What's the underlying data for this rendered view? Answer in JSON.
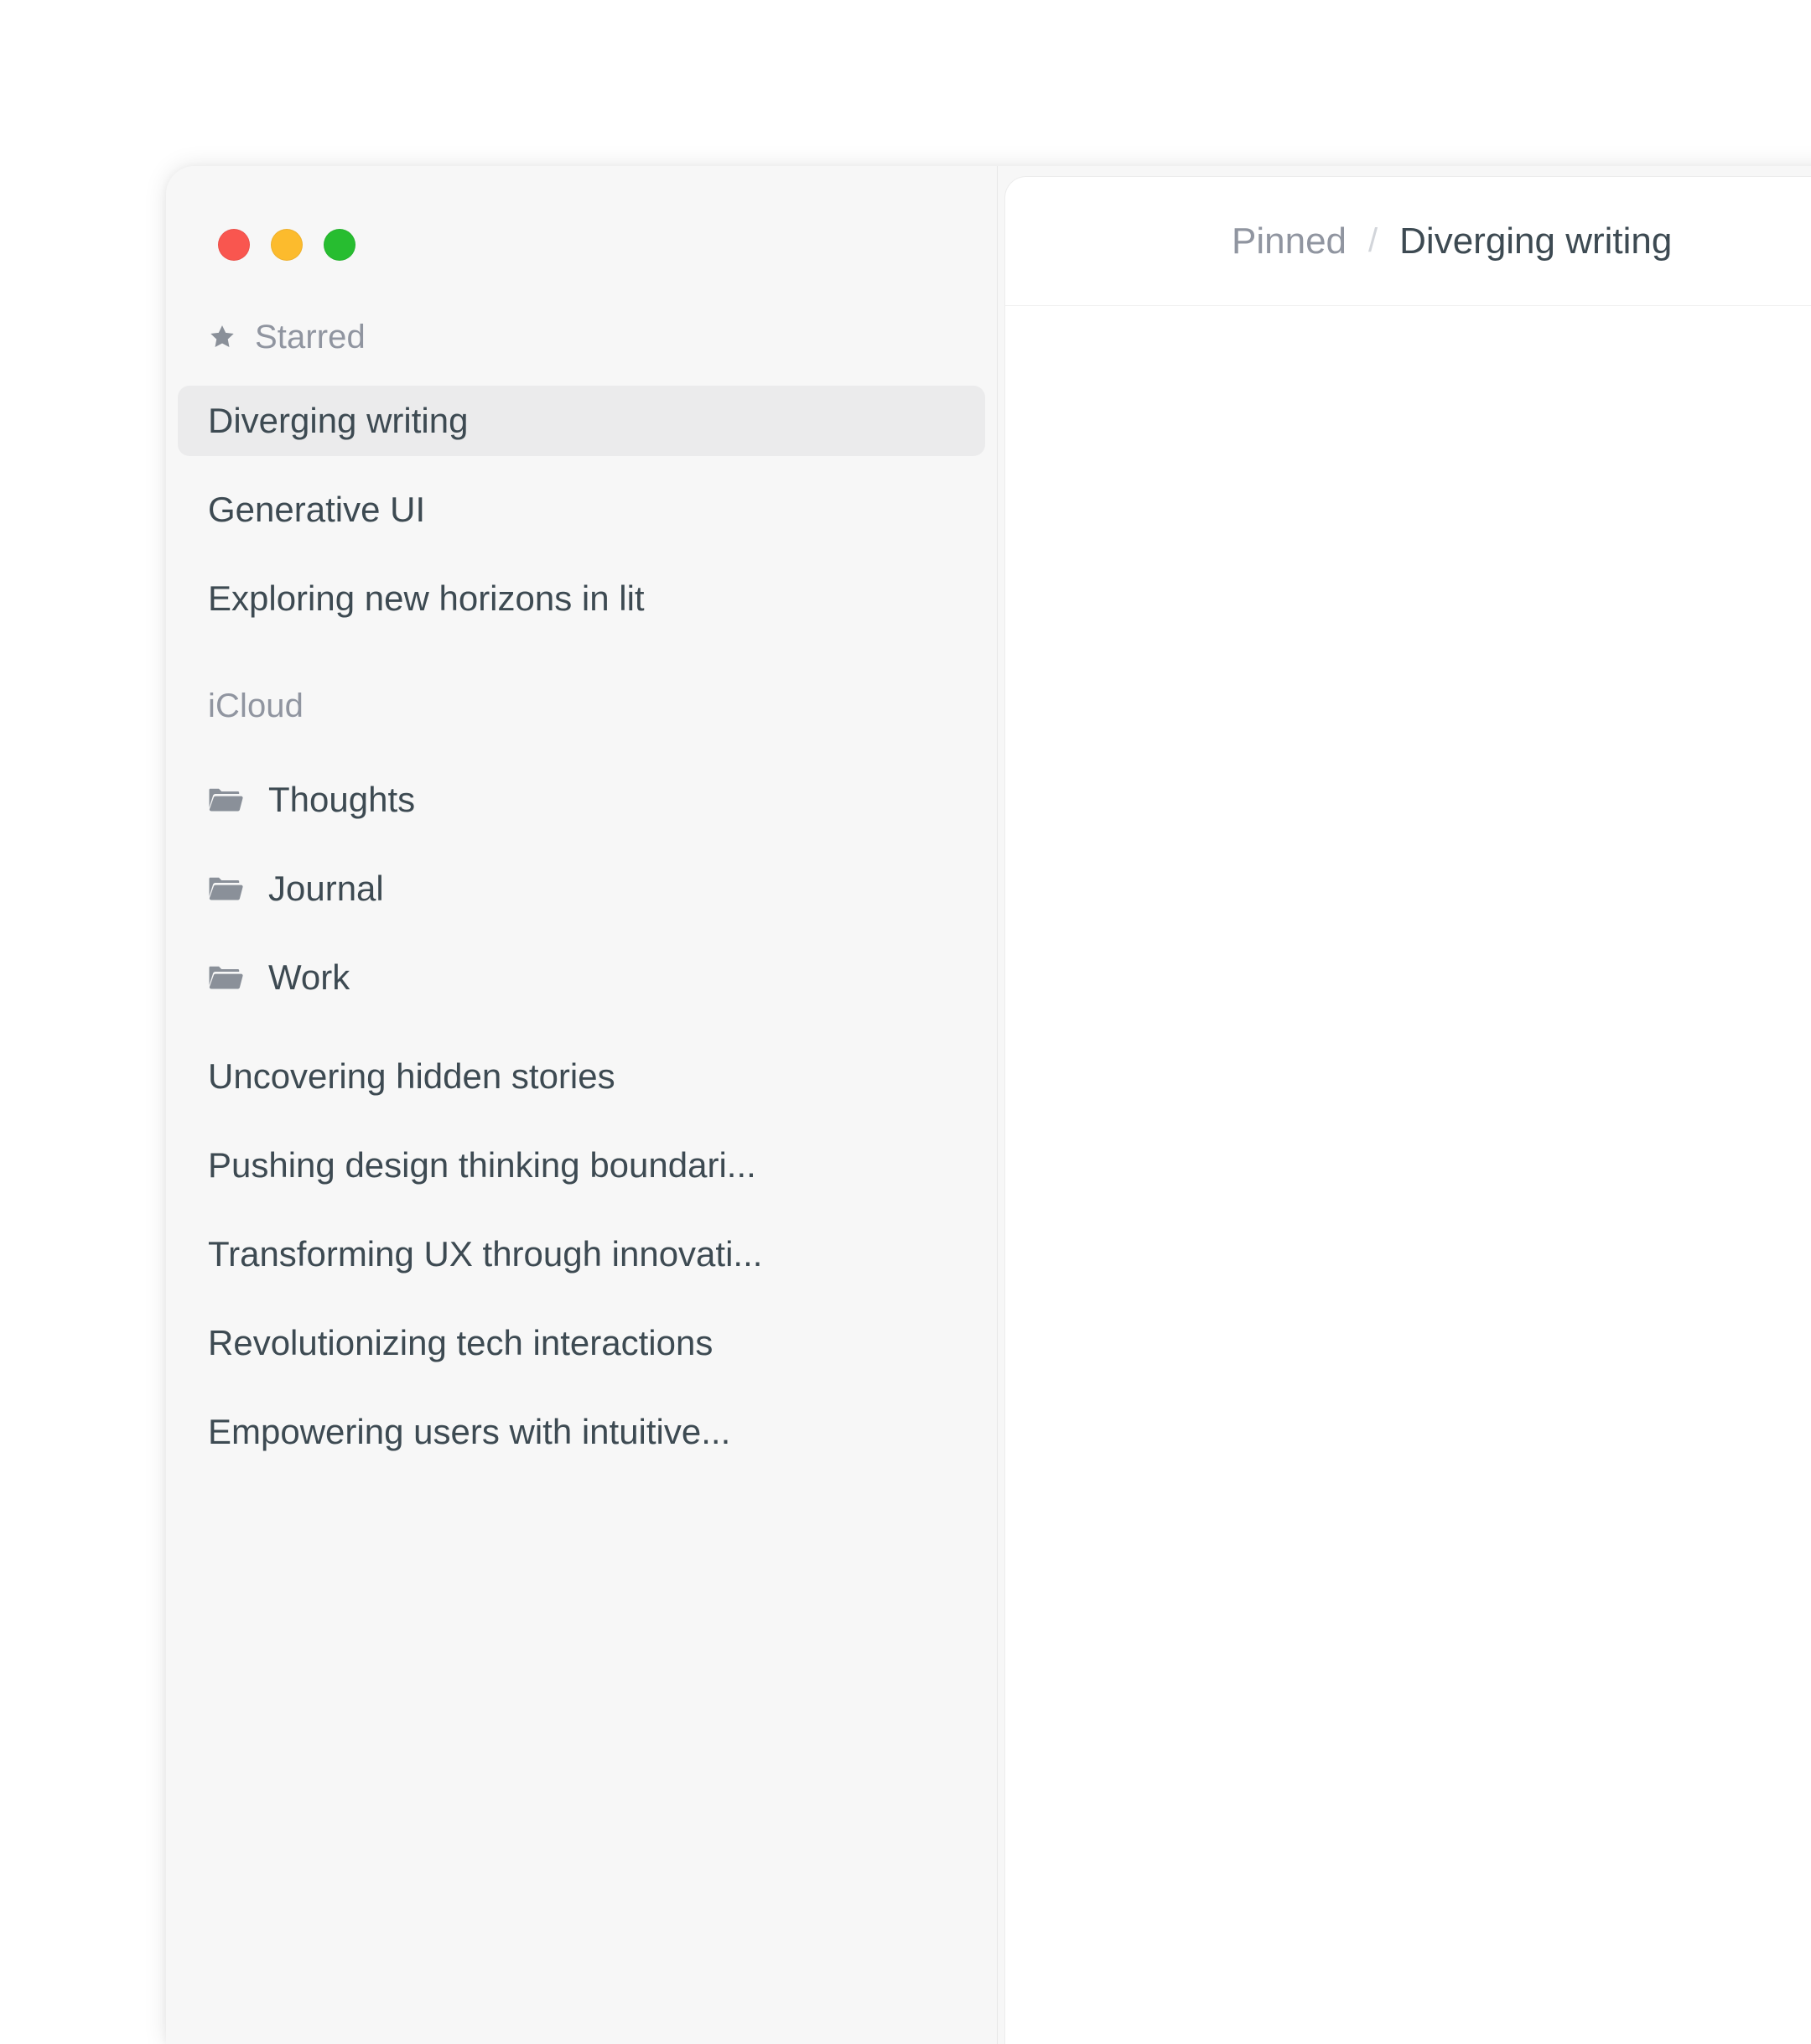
{
  "window": {
    "traffic_lights": [
      {
        "name": "close",
        "color": "#f9564f"
      },
      {
        "name": "minimize",
        "color": "#fcbb2d"
      },
      {
        "name": "maximize",
        "color": "#27bd30"
      }
    ]
  },
  "sidebar": {
    "starred_section": {
      "icon": "star-icon",
      "label": "Starred",
      "items": [
        {
          "label": "Diverging writing",
          "selected": true
        },
        {
          "label": "Generative UI",
          "selected": false
        },
        {
          "label": "Exploring new horizons in lit",
          "selected": false
        }
      ]
    },
    "icloud_section": {
      "label": "iCloud",
      "folders": [
        {
          "icon": "folder-icon",
          "label": "Thoughts"
        },
        {
          "icon": "folder-icon",
          "label": "Journal"
        },
        {
          "icon": "folder-icon",
          "label": "Work"
        }
      ],
      "notes": [
        {
          "label": "Uncovering hidden stories"
        },
        {
          "label": "Pushing design thinking boundari..."
        },
        {
          "label": "Transforming UX through innovati..."
        },
        {
          "label": "Revolutionizing tech interactions"
        },
        {
          "label": "Empowering users with intuitive..."
        },
        {
          "label": ""
        }
      ]
    }
  },
  "content": {
    "breadcrumb": {
      "parent": "Pinned",
      "separator": "/",
      "current": "Diverging writing"
    }
  },
  "colors": {
    "sidebar_bg": "#f7f7f7",
    "panel_bg": "#ffffff",
    "text_primary": "#3d4a52",
    "text_muted": "#9095a0",
    "selected_bg": "#ebebec",
    "divider": "#ececec"
  }
}
